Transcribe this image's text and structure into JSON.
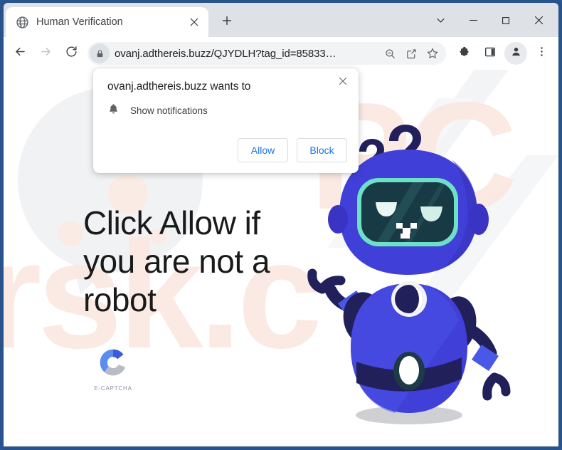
{
  "browser": {
    "tab": {
      "title": "Human Verification",
      "favicon_icon": "globe-icon",
      "close_icon": "close-icon"
    },
    "new_tab_icon": "plus-icon",
    "window_controls": {
      "more_icon": "chevron-down-icon",
      "minimize_icon": "minimize-icon",
      "maximize_icon": "maximize-icon",
      "close_icon": "close-icon"
    },
    "toolbar": {
      "back_icon": "back-arrow-icon",
      "forward_icon": "forward-arrow-icon",
      "reload_icon": "reload-icon",
      "lock_icon": "lock-icon",
      "url": "ovanj.adthereis.buzz/QJYDLH?tag_id=85833…",
      "zoom_out_icon": "zoom-out-icon",
      "share_icon": "share-icon",
      "bookmark_icon": "star-icon",
      "extensions_icon": "puzzle-piece-icon",
      "side_panel_icon": "side-panel-icon",
      "profile_icon": "profile-avatar-icon",
      "menu_icon": "three-dot-menu-icon"
    }
  },
  "permission_dialog": {
    "title": "ovanj.adthereis.buzz wants to",
    "close_icon": "close-icon",
    "request": {
      "icon": "bell-icon",
      "label": "Show notifications"
    },
    "allow_label": "Allow",
    "block_label": "Block"
  },
  "page": {
    "headline": "Click Allow if you are not a robot",
    "captcha": {
      "logo_icon": "c-ring-icon",
      "label": "E-CAPTCHA"
    },
    "mascot": {
      "name": "robot-mascot",
      "question_marks_icon": "question-marks-icon"
    }
  },
  "colors": {
    "window_frame": "#28538c",
    "tabstrip": "#dee1e6",
    "omnibox": "#f1f3f4",
    "link_blue": "#1a73e8",
    "robot_body": "#4040d9",
    "robot_dark": "#22205a",
    "visor": "#173a44",
    "visor_border": "#6ee0c8",
    "captcha_blue": "#3b5bdb",
    "captcha_light": "#5b8def",
    "captcha_gray": "#b9bcc4",
    "watermark": "#fdeee8"
  }
}
